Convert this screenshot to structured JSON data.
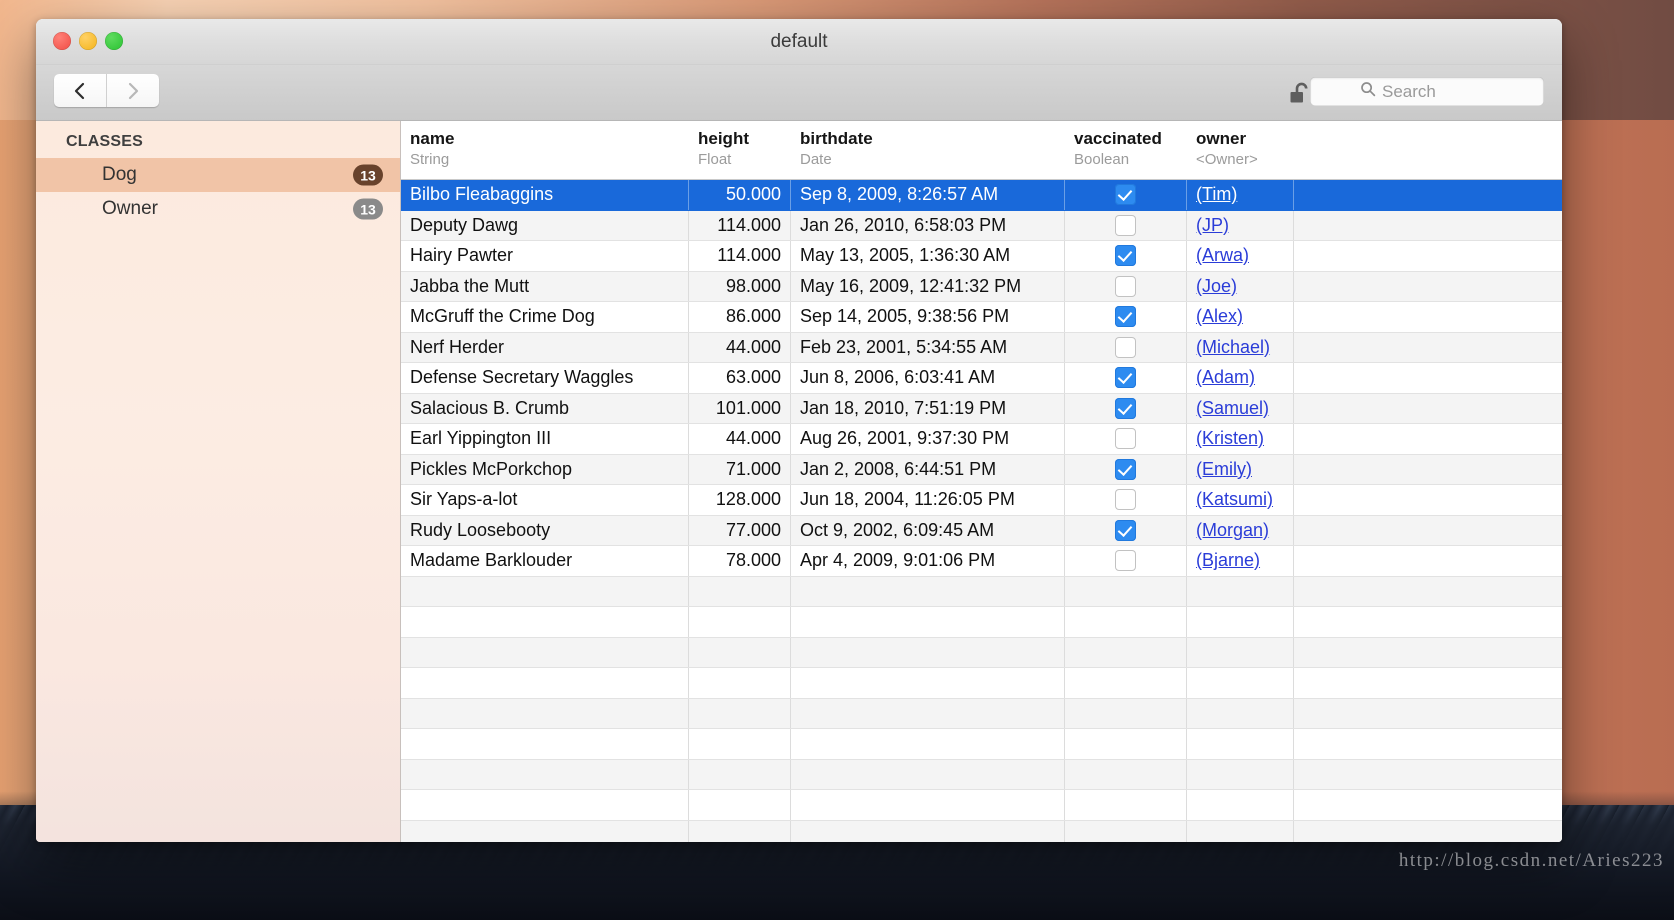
{
  "desktop": {
    "watermark": "http://blog.csdn.net/Aries223"
  },
  "window": {
    "title": "default",
    "traffic": {
      "close": "close-button",
      "minimize": "minimize-button",
      "zoom": "zoom-button"
    }
  },
  "toolbar": {
    "back_label": "‹",
    "forward_label": "›",
    "lock_state": "unlocked",
    "search_placeholder": "Search",
    "search_value": ""
  },
  "sidebar": {
    "header": "CLASSES",
    "items": [
      {
        "label": "Dog",
        "badge": "13",
        "selected": true
      },
      {
        "label": "Owner",
        "badge": "13",
        "selected": false
      }
    ]
  },
  "table": {
    "columns": [
      {
        "name": "name",
        "type": "String"
      },
      {
        "name": "height",
        "type": "Float"
      },
      {
        "name": "birthdate",
        "type": "Date"
      },
      {
        "name": "vaccinated",
        "type": "Boolean"
      },
      {
        "name": "owner",
        "type": "<Owner>"
      }
    ],
    "rows": [
      {
        "name": "Bilbo Fleabaggins",
        "height": "50.000",
        "birthdate": "Sep 8, 2009, 8:26:57 AM",
        "vaccinated": true,
        "owner": "(Tim)",
        "selected": true
      },
      {
        "name": "Deputy Dawg",
        "height": "114.000",
        "birthdate": "Jan 26, 2010, 6:58:03 PM",
        "vaccinated": false,
        "owner": "(JP)",
        "selected": false
      },
      {
        "name": "Hairy Pawter",
        "height": "114.000",
        "birthdate": "May 13, 2005, 1:36:30 AM",
        "vaccinated": true,
        "owner": "(Arwa)",
        "selected": false
      },
      {
        "name": "Jabba the Mutt",
        "height": "98.000",
        "birthdate": "May 16, 2009, 12:41:32 PM",
        "vaccinated": false,
        "owner": "(Joe)",
        "selected": false
      },
      {
        "name": "McGruff the Crime Dog",
        "height": "86.000",
        "birthdate": "Sep 14, 2005, 9:38:56 PM",
        "vaccinated": true,
        "owner": "(Alex)",
        "selected": false
      },
      {
        "name": "Nerf Herder",
        "height": "44.000",
        "birthdate": "Feb 23, 2001, 5:34:55 AM",
        "vaccinated": false,
        "owner": "(Michael)",
        "selected": false
      },
      {
        "name": "Defense Secretary Waggles",
        "height": "63.000",
        "birthdate": "Jun 8, 2006, 6:03:41 AM",
        "vaccinated": true,
        "owner": "(Adam)",
        "selected": false
      },
      {
        "name": "Salacious B. Crumb",
        "height": "101.000",
        "birthdate": "Jan 18, 2010, 7:51:19 PM",
        "vaccinated": true,
        "owner": "(Samuel)",
        "selected": false
      },
      {
        "name": "Earl Yippington III",
        "height": "44.000",
        "birthdate": "Aug 26, 2001, 9:37:30 PM",
        "vaccinated": false,
        "owner": "(Kristen)",
        "selected": false
      },
      {
        "name": "Pickles McPorkchop",
        "height": "71.000",
        "birthdate": "Jan 2, 2008, 6:44:51 PM",
        "vaccinated": true,
        "owner": "(Emily)",
        "selected": false
      },
      {
        "name": "Sir Yaps-a-lot",
        "height": "128.000",
        "birthdate": "Jun 18, 2004, 11:26:05 PM",
        "vaccinated": false,
        "owner": "(Katsumi)",
        "selected": false
      },
      {
        "name": "Rudy Loosebooty",
        "height": "77.000",
        "birthdate": "Oct 9, 2002, 6:09:45 AM",
        "vaccinated": true,
        "owner": "(Morgan)",
        "selected": false
      },
      {
        "name": "Madame Barklouder",
        "height": "78.000",
        "birthdate": "Apr 4, 2009, 9:01:06 PM",
        "vaccinated": false,
        "owner": "(Bjarne)",
        "selected": false
      }
    ],
    "empty_row_count": 9
  },
  "colors": {
    "selection_blue": "#1969da",
    "checkbox_blue": "#2d8bf0",
    "link_blue": "#2a3cd8",
    "sidebar_selected": "#eaac85",
    "badge_selected": "#68422c",
    "badge_default": "#8a8a8a"
  }
}
